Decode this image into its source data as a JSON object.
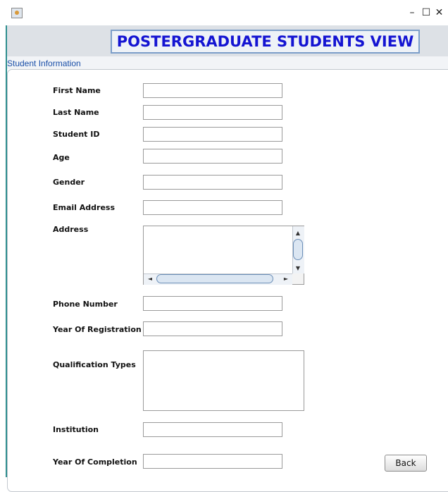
{
  "window": {
    "minimize_glyph": "–",
    "maximize_glyph": "☐",
    "close_glyph": "✕",
    "app_icon": "java-app-icon"
  },
  "header": {
    "title": "POSTERGRADUATE STUDENTS VIEW",
    "title_color": "#1414d2"
  },
  "section": {
    "title": "Student Information",
    "title_color": "#1a4fa8"
  },
  "form": {
    "first_name": {
      "label": "First Name",
      "value": ""
    },
    "last_name": {
      "label": "Last Name",
      "value": ""
    },
    "student_id": {
      "label": "Student ID",
      "value": ""
    },
    "age": {
      "label": "Age",
      "value": ""
    },
    "gender": {
      "label": "Gender",
      "value": ""
    },
    "email": {
      "label": "Email Address",
      "value": ""
    },
    "address": {
      "label": "Address",
      "value": ""
    },
    "phone": {
      "label": "Phone Number",
      "value": ""
    },
    "year_registration": {
      "label": "Year Of Registration",
      "value": ""
    },
    "qualification_types": {
      "label": "Qualification Types",
      "value": ""
    },
    "institution": {
      "label": "Institution",
      "value": ""
    },
    "year_completion": {
      "label": "Year Of Completion",
      "value": ""
    }
  },
  "actions": {
    "back_label": "Back"
  },
  "scroll_arrows": {
    "up": "▲",
    "down": "▼",
    "left": "◄",
    "right": "►"
  }
}
